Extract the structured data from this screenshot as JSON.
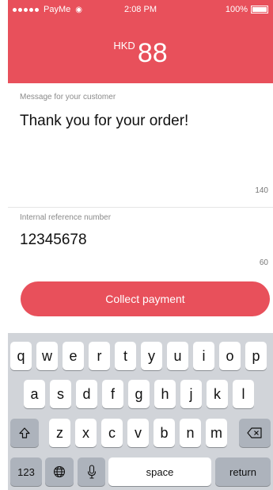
{
  "status_bar": {
    "carrier": "PayMe",
    "time": "2:08 PM",
    "battery": "100%"
  },
  "header": {
    "currency": "HKD",
    "amount": "88"
  },
  "message_field": {
    "label": "Message for your customer",
    "value": "Thank you for your order!",
    "counter": "140"
  },
  "reference_field": {
    "label": "Internal reference number",
    "value": "12345678",
    "counter": "60"
  },
  "collect_button": {
    "label": "Collect payment"
  },
  "colors": {
    "accent": "#e8505b",
    "keyboard_bg": "#d1d4d9"
  },
  "keyboard": {
    "row1": [
      "q",
      "w",
      "e",
      "r",
      "t",
      "y",
      "u",
      "i",
      "o",
      "p"
    ],
    "row2": [
      "a",
      "s",
      "d",
      "f",
      "g",
      "h",
      "j",
      "k",
      "l"
    ],
    "row3": [
      "z",
      "x",
      "c",
      "v",
      "b",
      "n",
      "m"
    ],
    "numbers_label": "123",
    "space_label": "space",
    "return_label": "return",
    "icons": [
      "shift-icon",
      "delete-icon",
      "globe-icon",
      "microphone-icon"
    ]
  }
}
